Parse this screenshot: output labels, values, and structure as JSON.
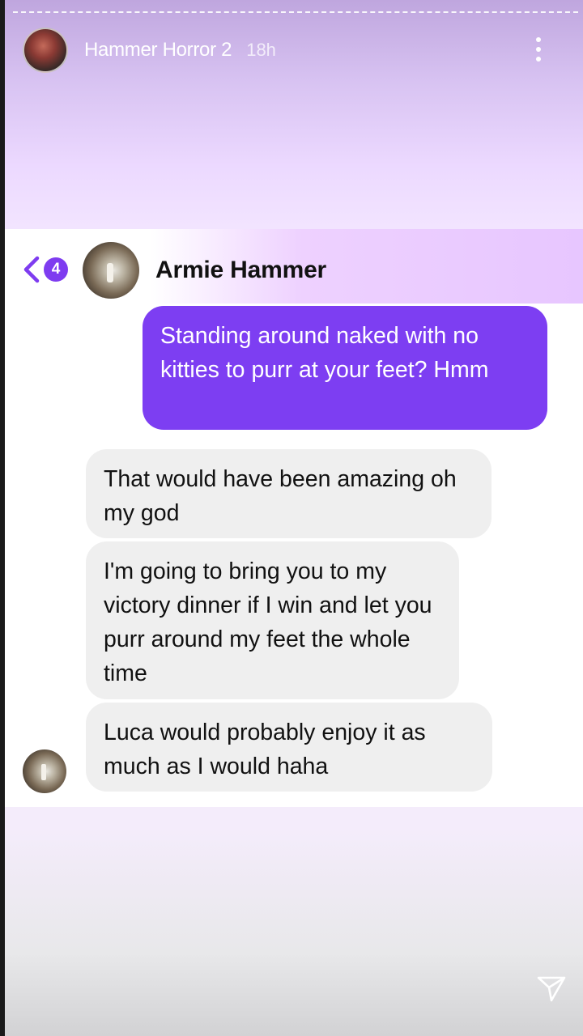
{
  "story": {
    "username": "Hammer Horror 2",
    "time_ago": "18h"
  },
  "conversation": {
    "unread_count": "4",
    "contact_name": "Armie Hammer",
    "messages": [
      {
        "direction": "outgoing",
        "text": "Standing around naked with no kitties to purr at your feet? Hmm"
      },
      {
        "direction": "incoming",
        "text": "That would have been amazing oh my god"
      },
      {
        "direction": "incoming",
        "text": "I'm going to bring you to my victory dinner if I win and let you purr around my feet the whole time"
      },
      {
        "direction": "incoming",
        "text": "Luca would probably enjoy it as much as I would haha"
      }
    ]
  },
  "colors": {
    "accent": "#7d3ef2",
    "incoming_bubble": "#efefef"
  },
  "icons": {
    "back": "chevron-left-icon",
    "more": "more-vertical-icon",
    "send": "send-icon"
  }
}
